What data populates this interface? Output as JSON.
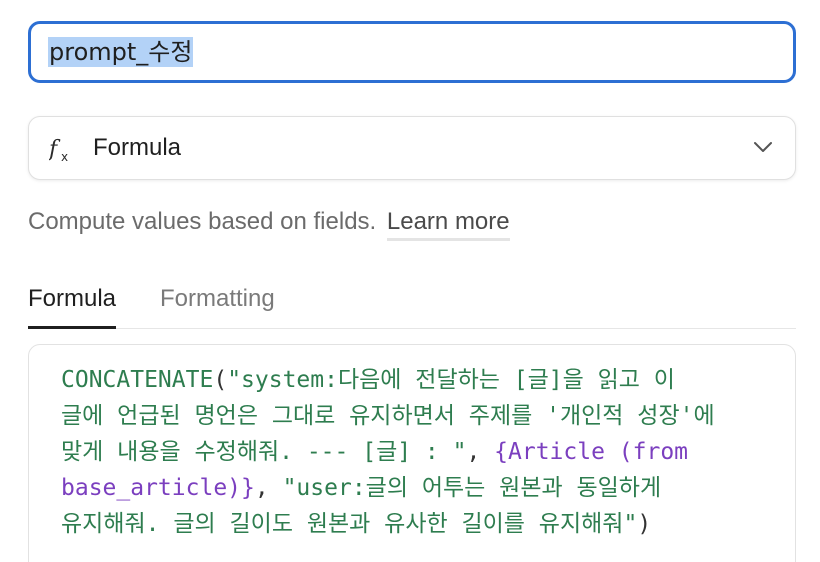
{
  "field": {
    "name_value": "prompt_수정"
  },
  "type_select": {
    "icon": "formula-fx-icon",
    "label": "Formula"
  },
  "description": {
    "text": "Compute values based on fields.",
    "link_label": "Learn more"
  },
  "tabs": [
    {
      "label": "Formula",
      "active": true
    },
    {
      "label": "Formatting",
      "active": false
    }
  ],
  "formula": {
    "lines": [
      [
        {
          "kind": "fn",
          "text": "CONCATENATE"
        },
        {
          "kind": "punct",
          "text": "("
        },
        {
          "kind": "str",
          "text": "\"system:다음에 전달하는 [글]을 읽고 이"
        }
      ],
      [
        {
          "kind": "str",
          "text": "글에 언급된 명언은 그대로 유지하면서 주제를 '개인적 성장'에"
        }
      ],
      [
        {
          "kind": "str",
          "text": "맞게 내용을 수정해줘. --- [글] : \""
        },
        {
          "kind": "punct",
          "text": ", "
        },
        {
          "kind": "ref",
          "text": "{Article (from"
        }
      ],
      [
        {
          "kind": "ref",
          "text": "base_article)}"
        },
        {
          "kind": "punct",
          "text": ", "
        },
        {
          "kind": "str",
          "text": "\"user:글의 어투는 원본과 동일하게"
        }
      ],
      [
        {
          "kind": "str",
          "text": "유지해줘. 글의 길이도 원본과 유사한 길이를 유지해줘\""
        },
        {
          "kind": "punct",
          "text": ")"
        }
      ]
    ]
  },
  "colors": {
    "focus_border": "#2d6fd3",
    "selection": "#b3d2f7",
    "function": "#2e7d4f",
    "string": "#2e7d4f",
    "field_ref": "#7b3fbf"
  }
}
